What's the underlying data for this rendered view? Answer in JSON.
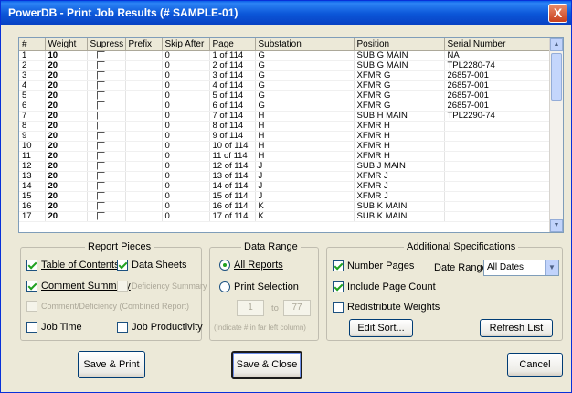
{
  "window": {
    "title": "PowerDB - Print Job Results (# SAMPLE-01)",
    "close_label": "X"
  },
  "grid": {
    "headers": [
      "#",
      "Weight",
      "Supress",
      "Prefix",
      "Skip After",
      "Page",
      "Substation",
      "Position",
      "Serial Number"
    ],
    "rows": [
      [
        "1",
        "10",
        "",
        "",
        "0",
        "1 of 114",
        "G",
        "SUB G MAIN",
        "NA"
      ],
      [
        "2",
        "20",
        "",
        "",
        "0",
        "2 of 114",
        "G",
        "SUB G MAIN",
        "TPL2280-74"
      ],
      [
        "3",
        "20",
        "",
        "",
        "0",
        "3 of 114",
        "G",
        "XFMR G",
        "26857-001"
      ],
      [
        "4",
        "20",
        "",
        "",
        "0",
        "4 of 114",
        "G",
        "XFMR G",
        "26857-001"
      ],
      [
        "5",
        "20",
        "",
        "",
        "0",
        "5 of 114",
        "G",
        "XFMR G",
        "26857-001"
      ],
      [
        "6",
        "20",
        "",
        "",
        "0",
        "6 of 114",
        "G",
        "XFMR G",
        "26857-001"
      ],
      [
        "7",
        "20",
        "",
        "",
        "0",
        "7 of 114",
        "H",
        "SUB H MAIN",
        "TPL2290-74"
      ],
      [
        "8",
        "20",
        "",
        "",
        "0",
        "8 of 114",
        "H",
        "XFMR H",
        ""
      ],
      [
        "9",
        "20",
        "",
        "",
        "0",
        "9 of 114",
        "H",
        "XFMR H",
        ""
      ],
      [
        "10",
        "20",
        "",
        "",
        "0",
        "10 of 114",
        "H",
        "XFMR H",
        ""
      ],
      [
        "11",
        "20",
        "",
        "",
        "0",
        "11 of 114",
        "H",
        "XFMR H",
        ""
      ],
      [
        "12",
        "20",
        "",
        "",
        "0",
        "12 of 114",
        "J",
        "SUB J MAIN",
        ""
      ],
      [
        "13",
        "20",
        "",
        "",
        "0",
        "13 of 114",
        "J",
        "XFMR J",
        ""
      ],
      [
        "14",
        "20",
        "",
        "",
        "0",
        "14 of 114",
        "J",
        "XFMR J",
        ""
      ],
      [
        "15",
        "20",
        "",
        "",
        "0",
        "15 of 114",
        "J",
        "XFMR J",
        ""
      ],
      [
        "16",
        "20",
        "",
        "",
        "0",
        "16 of 114",
        "K",
        "SUB K MAIN",
        ""
      ],
      [
        "17",
        "20",
        "",
        "",
        "0",
        "17 of 114",
        "K",
        "SUB K MAIN",
        ""
      ]
    ]
  },
  "report_pieces": {
    "title": "Report Pieces",
    "table_of_contents": "Table of Contents",
    "data_sheets": "Data Sheets",
    "comment_summary": "Comment Summary",
    "deficiency_summary": "Deficiency Summary",
    "comment_deficiency": "Comment/Deficiency (Combined Report)",
    "job_time": "Job Time",
    "job_productivity": "Job Productivity"
  },
  "data_range": {
    "title": "Data Range",
    "all_reports": "All Reports",
    "print_selection": "Print Selection",
    "from": "1",
    "to_label": "to",
    "to": "77",
    "hint": "(Indicate # in far left column)"
  },
  "additional": {
    "title": "Additional Specifications",
    "number_pages": "Number Pages",
    "include_page_count": "Include Page Count",
    "redistribute_weights": "Redistribute Weights",
    "date_range_label": "Date Range:",
    "date_range_value": "All Dates",
    "edit_sort": "Edit Sort...",
    "refresh_list": "Refresh List"
  },
  "buttons": {
    "save_print": "Save & Print",
    "save_close": "Save & Close",
    "cancel": "Cancel"
  },
  "colors": {
    "title_bar": "#0b56d8",
    "check": "#21a121",
    "face": "#ece9d8"
  }
}
